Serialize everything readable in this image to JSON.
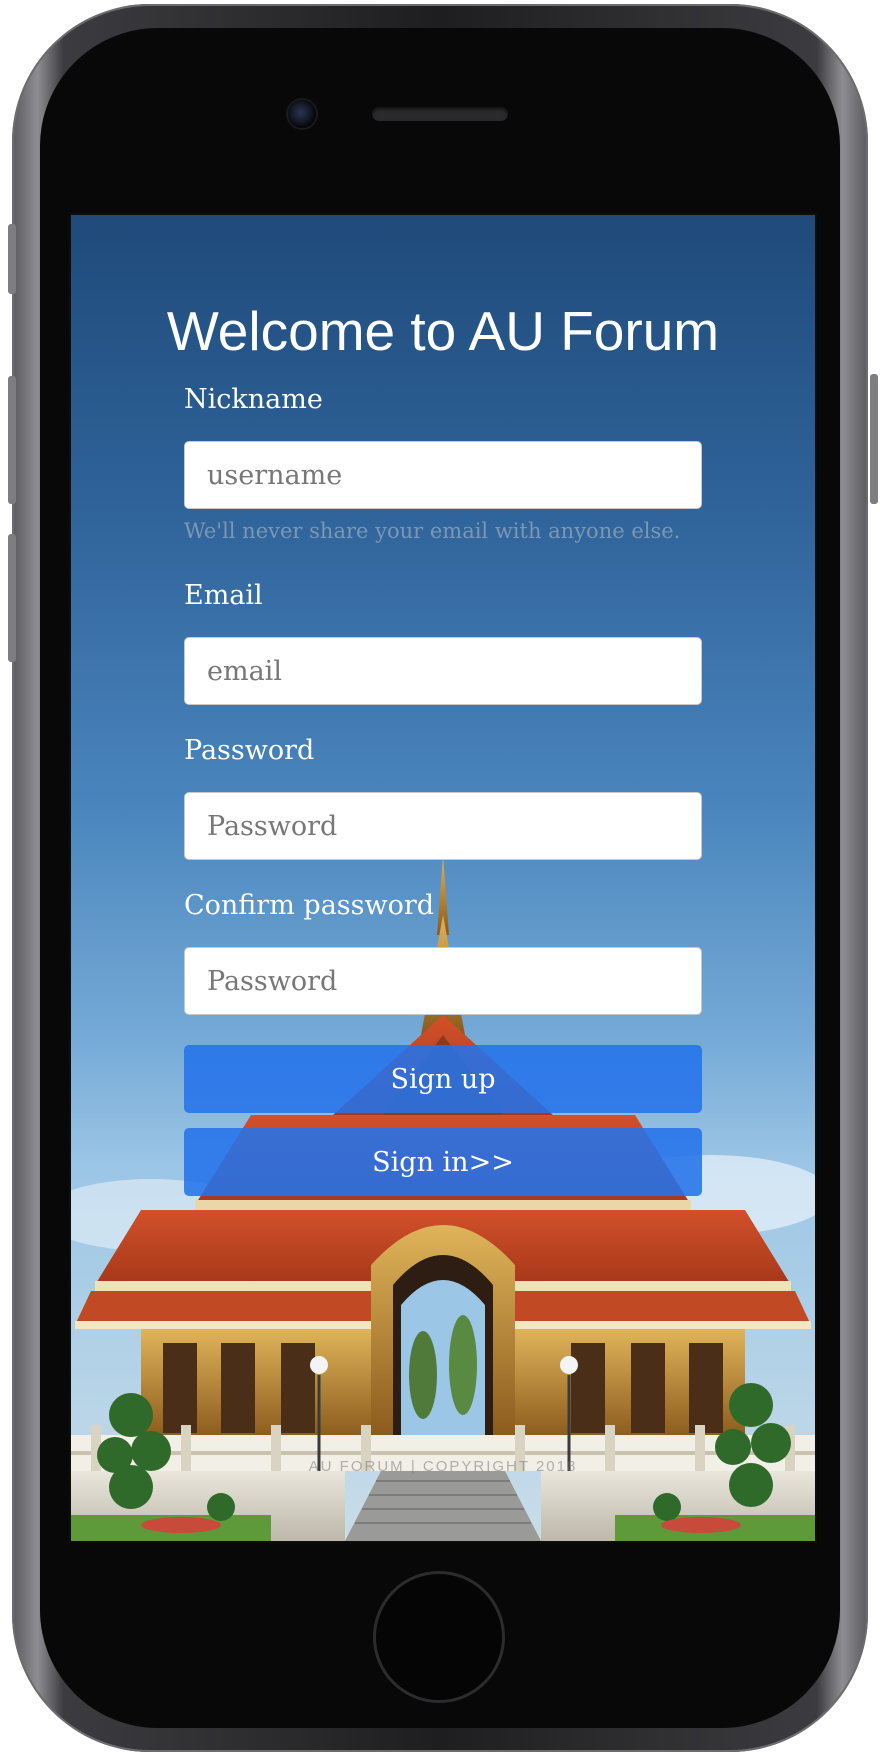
{
  "form": {
    "title": "Welcome to AU Forum",
    "nickname_label": "Nickname",
    "nickname_placeholder": "username",
    "nickname_help": "We'll never share your email with anyone else.",
    "email_label": "Email",
    "email_placeholder": "email",
    "password_label": "Password",
    "password_placeholder": "Password",
    "confirm_label": "Confirm password",
    "confirm_placeholder": "Password",
    "signup_label": "Sign up",
    "signin_label": "Sign in>>"
  },
  "footer": {
    "text": "AU FORUM | COPYRIGHT 2018"
  },
  "colors": {
    "button": "#2473eb",
    "sky_top": "#1f4a7a",
    "sky_bottom": "#9cc6e6",
    "roof": "#c2451f",
    "gold": "#c99a3a"
  }
}
